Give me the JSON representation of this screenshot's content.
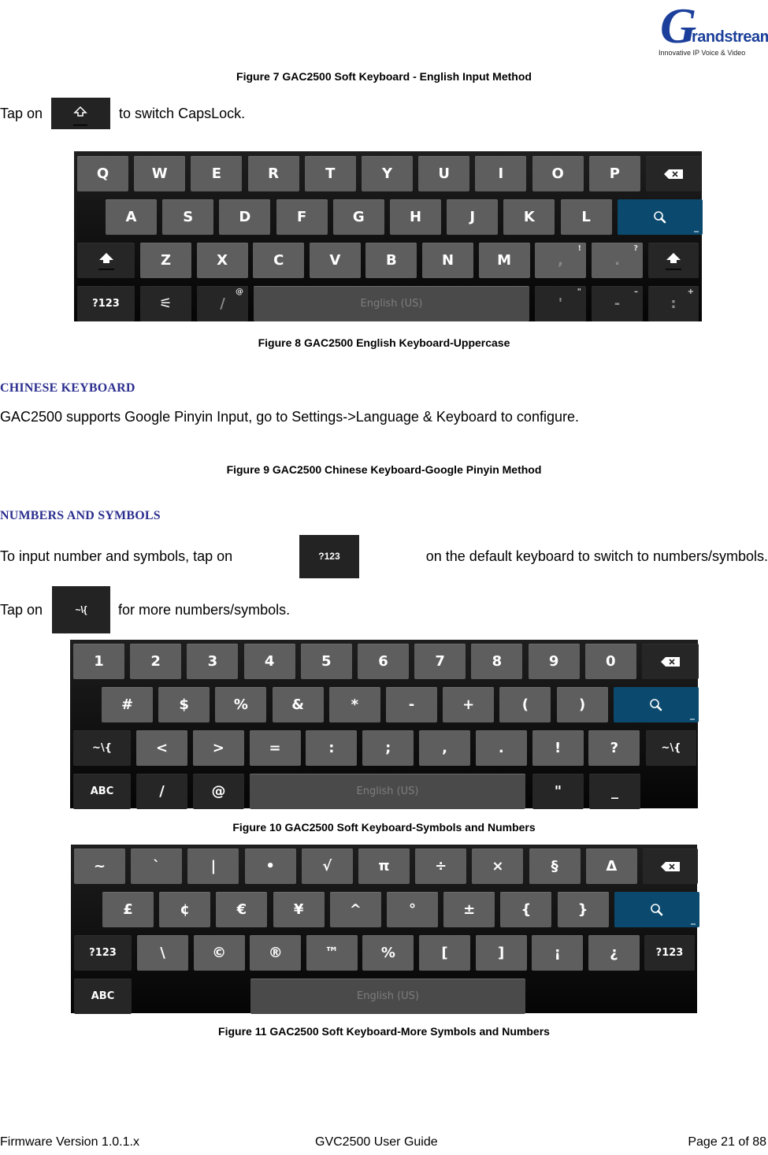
{
  "logo": {
    "brand": "randstream",
    "initial": "G",
    "tagline": "Innovative IP Voice & Video"
  },
  "figure7_caption": "Figure 7 GAC2500 Soft Keyboard - English Input Method",
  "caps_text": {
    "before": "Tap on",
    "after": "to switch CapsLock."
  },
  "figure8": {
    "caption": "Figure 8 GAC2500 English Keyboard-Uppercase",
    "row1": [
      "Q",
      "W",
      "E",
      "R",
      "T",
      "Y",
      "U",
      "I",
      "O",
      "P"
    ],
    "row2": [
      "A",
      "S",
      "D",
      "F",
      "G",
      "H",
      "J",
      "K",
      "L"
    ],
    "row3": [
      "Z",
      "X",
      "C",
      "V",
      "B",
      "N",
      "M"
    ],
    "comma": {
      "main": ",",
      "hint": "!"
    },
    "period": {
      "main": ".",
      "hint": "?"
    },
    "sym_key": "?123",
    "settings_icon": "⚟",
    "slash": {
      "main": "/",
      "hint": "@"
    },
    "space": "English (US)",
    "apostrophe": {
      "main": "'",
      "hint": "\""
    },
    "dash": {
      "main": "-",
      "hint": "–"
    },
    "colon": {
      "main": ":",
      "hint": "+"
    }
  },
  "chinese_section": {
    "heading": "CHINESE KEYBOARD",
    "text": "GAC2500 supports Google Pinyin Input, go to Settings->Language & Keyboard to configure.",
    "figure9_caption": "Figure 9 GAC2500 Chinese Keyboard-Google Pinyin Method"
  },
  "numbers_section": {
    "heading": "NUMBERS AND SYMBOLS",
    "line1_before": "To input number and symbols, tap on",
    "line1_key": "?123",
    "line1_after": "on the default keyboard to switch to numbers/symbols.",
    "line2_before": "Tap on",
    "line2_key": "~\\{",
    "line2_after": "for more numbers/symbols."
  },
  "figure10": {
    "caption": "Figure 10 GAC2500 Soft Keyboard-Symbols and Numbers",
    "row1": [
      "1",
      "2",
      "3",
      "4",
      "5",
      "6",
      "7",
      "8",
      "9",
      "0"
    ],
    "row2": [
      "#",
      "$",
      "%",
      "&",
      "*",
      "-",
      "+",
      "(",
      ")"
    ],
    "row3_left": "~\\{",
    "row3": [
      "<",
      ">",
      "=",
      ":",
      ";",
      ",",
      ".",
      "!",
      "?"
    ],
    "row3_right": "~\\{",
    "row4_abc": "ABC",
    "row4_slash": "/",
    "row4_at": "@",
    "space": "English (US)",
    "row4_quote": "\"",
    "row4_underscore": "_"
  },
  "figure11": {
    "caption": "Figure 11 GAC2500 Soft Keyboard-More Symbols and Numbers",
    "row1": [
      "~",
      "`",
      "|",
      "•",
      "√",
      "π",
      "÷",
      "×",
      "§",
      "Δ"
    ],
    "row2": [
      "£",
      "¢",
      "€",
      "¥",
      "^",
      "°",
      "±",
      "{",
      "}"
    ],
    "row3_left": "?123",
    "row3": [
      "\\",
      "©",
      "®",
      "™",
      "%",
      "[",
      "]",
      "¡",
      "¿"
    ],
    "row3_right": "?123",
    "row4_abc": "ABC",
    "space": "English (US)"
  },
  "footer": {
    "left": "Firmware Version 1.0.1.x",
    "center": "GVC2500 User Guide",
    "right": "Page 21 of 88"
  }
}
